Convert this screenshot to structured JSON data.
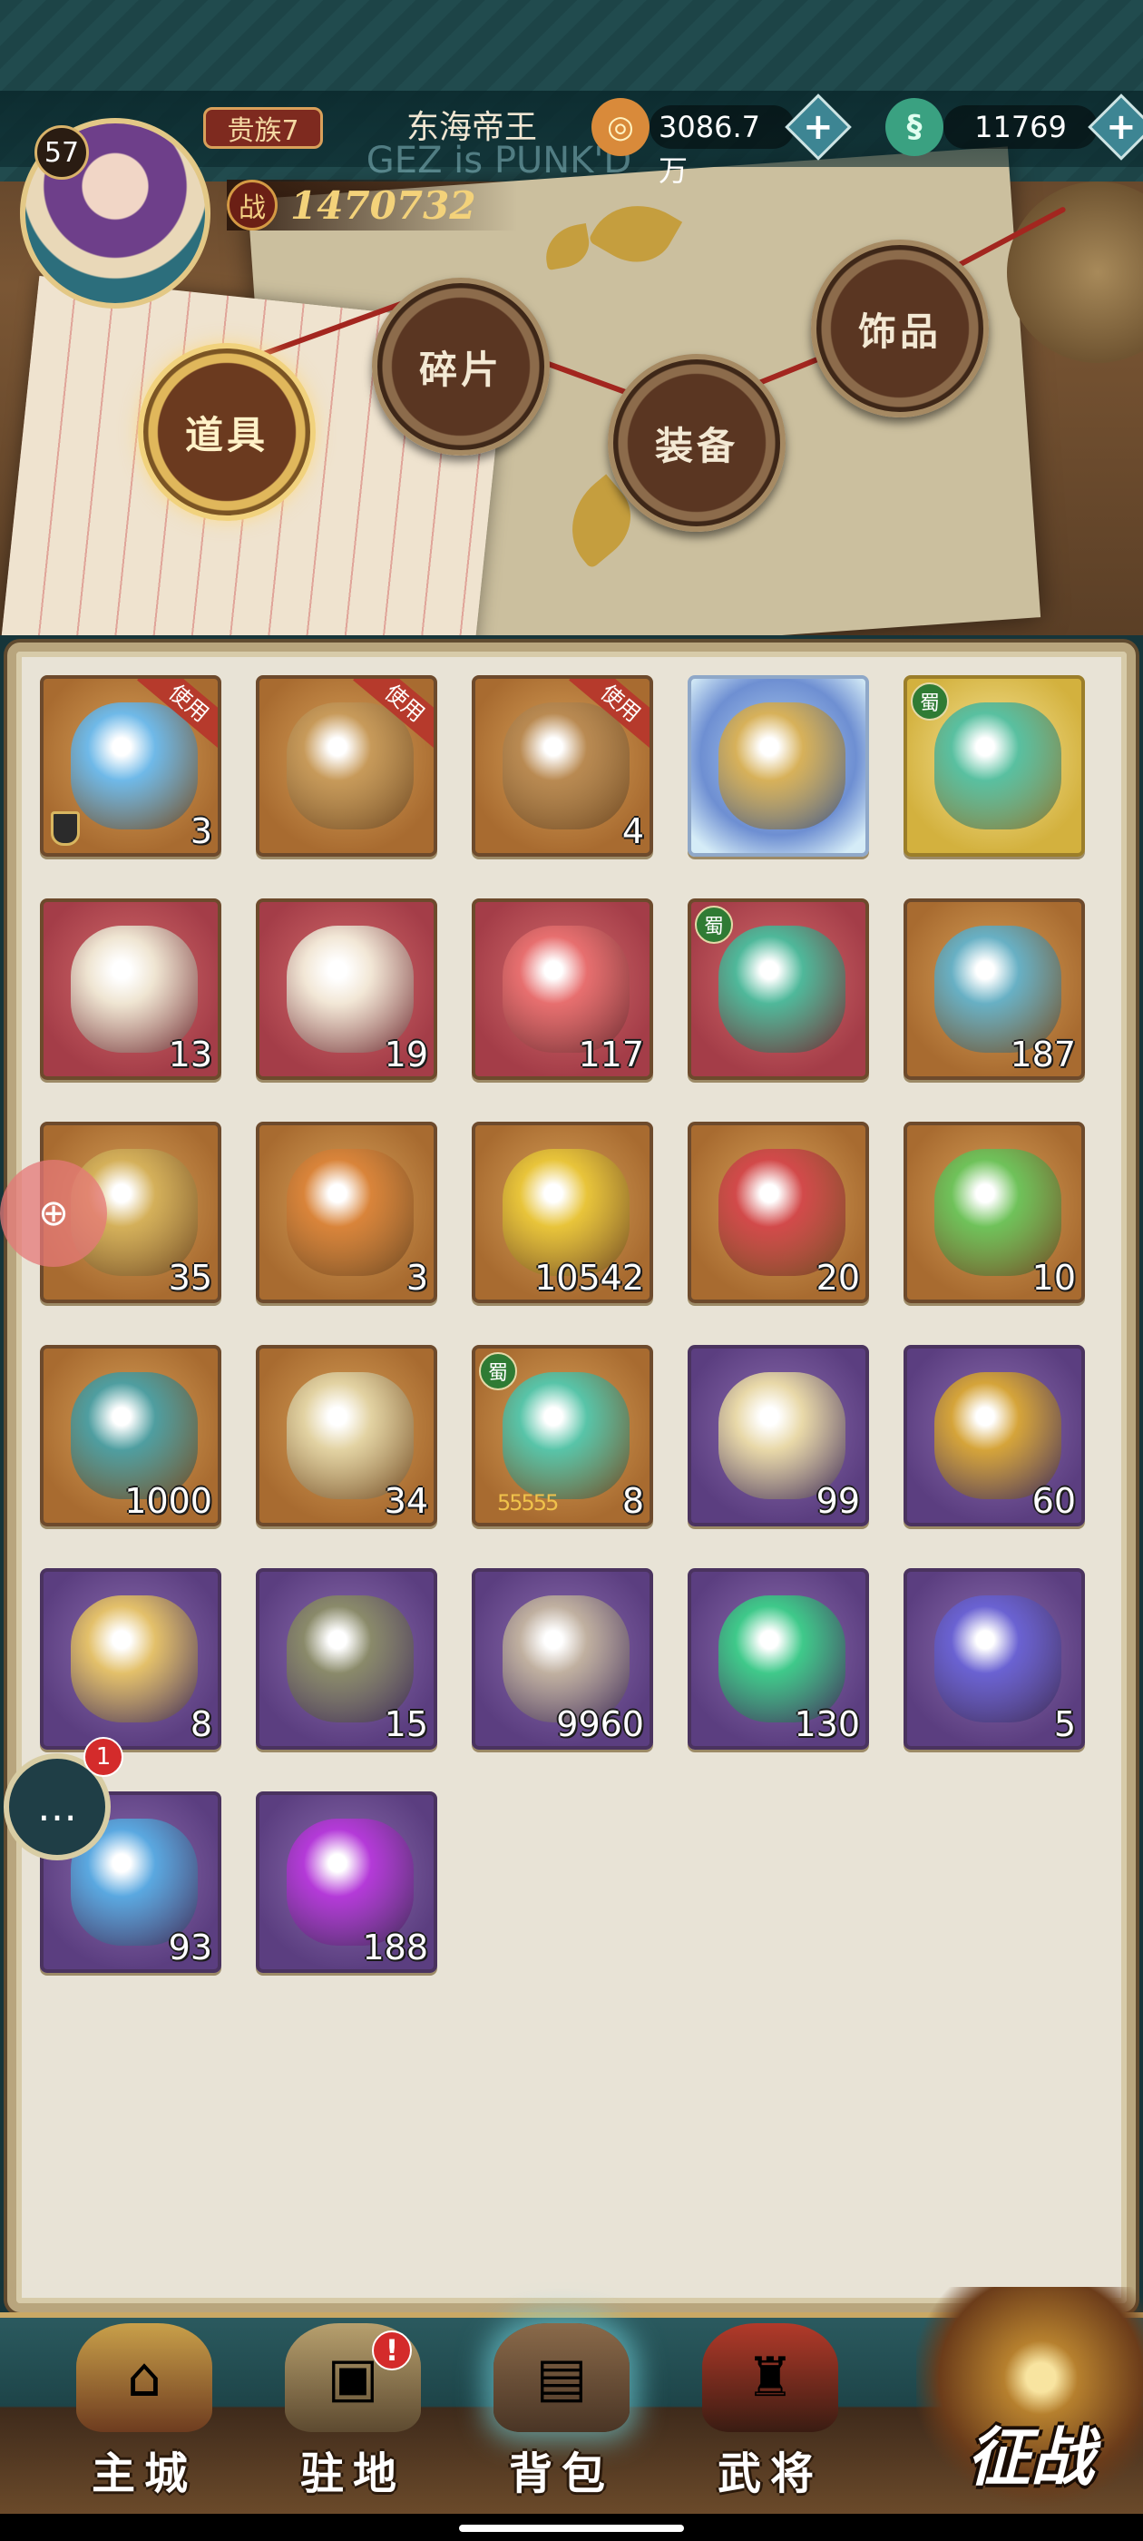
{
  "header": {
    "level": "57",
    "rank": "贵族7",
    "player_name": "东海帝王",
    "watermark": "GEZ is PUNK'D",
    "power_icon_label": "战",
    "power": "1470732",
    "currencies": [
      {
        "icon": "copper-coin-icon",
        "value": "3086.7万",
        "color": "#d98a3a"
      },
      {
        "icon": "jade-dragon-icon",
        "value": "11769",
        "color": "#3aa181"
      }
    ]
  },
  "category_tabs": [
    {
      "label": "道具",
      "active": true
    },
    {
      "label": "碎片",
      "active": false
    },
    {
      "label": "装备",
      "active": false
    },
    {
      "label": "饰品",
      "active": false
    }
  ],
  "inventory": {
    "use_tag": "使用",
    "faction_tag": "蜀",
    "items": [
      {
        "icon": "mystery-stone-icon",
        "count": "3",
        "rarity": "orange",
        "use": true,
        "lock": true
      },
      {
        "icon": "treasure-chest-icon",
        "count": "",
        "rarity": "orange",
        "use": true
      },
      {
        "icon": "orb-crate-icon",
        "count": "4",
        "rarity": "orange",
        "use": true
      },
      {
        "icon": "golden-crown-emblem-icon",
        "count": "",
        "rarity": "blue"
      },
      {
        "icon": "faction-orb-pendant-icon",
        "count": "",
        "rarity": "gold",
        "faction": true
      },
      {
        "icon": "ivory-horn-icon",
        "count": "13",
        "rarity": "red"
      },
      {
        "icon": "seashell-icon",
        "count": "19",
        "rarity": "red"
      },
      {
        "icon": "red-jade-lion-icon",
        "count": "117",
        "rarity": "red"
      },
      {
        "icon": "faction-jade-orb-icon",
        "count": "",
        "rarity": "red",
        "faction": true
      },
      {
        "icon": "sword-emblem-icon",
        "count": "187",
        "rarity": "orange"
      },
      {
        "icon": "golden-helmet-badge-icon",
        "count": "35",
        "rarity": "orange"
      },
      {
        "icon": "talisman-card-icon",
        "count": "3",
        "rarity": "orange"
      },
      {
        "icon": "golden-pearl-box-icon",
        "count": "10542",
        "rarity": "orange"
      },
      {
        "icon": "red-crystal-icon",
        "count": "20",
        "rarity": "orange"
      },
      {
        "icon": "green-crystal-icon",
        "count": "10",
        "rarity": "orange"
      },
      {
        "icon": "bronze-bell-icon",
        "count": "1000",
        "rarity": "orange"
      },
      {
        "icon": "jade-coin-icon",
        "count": "34",
        "rarity": "orange"
      },
      {
        "icon": "starred-faction-orb-icon",
        "count": "8",
        "rarity": "orange",
        "faction": true,
        "stars": "55555"
      },
      {
        "icon": "scroll-cards-icon",
        "count": "99",
        "rarity": "purple"
      },
      {
        "icon": "armillary-sphere-icon",
        "count": "60",
        "rarity": "purple"
      },
      {
        "icon": "imperial-scroll-icon",
        "count": "8",
        "rarity": "purple"
      },
      {
        "icon": "bronze-key-icon",
        "count": "15",
        "rarity": "purple"
      },
      {
        "icon": "dragon-dagger-icon",
        "count": "9960",
        "rarity": "purple"
      },
      {
        "icon": "green-flame-icon",
        "count": "130",
        "rarity": "purple"
      },
      {
        "icon": "purple-orb-icon",
        "count": "5",
        "rarity": "purple"
      },
      {
        "icon": "blue-ribbon-charm-icon",
        "count": "93",
        "rarity": "purple"
      },
      {
        "icon": "purple-gem-icon",
        "count": "188",
        "rarity": "purple"
      }
    ]
  },
  "floating": {
    "game_icon": "gamepad-icon",
    "chat_icon": "chat-bubble-icon",
    "chat_badge": "1"
  },
  "bottom_nav": {
    "items": [
      {
        "label": "主城",
        "icon": "palace-icon"
      },
      {
        "label": "驻地",
        "icon": "stronghold-icon",
        "alert": "!"
      },
      {
        "label": "背包",
        "icon": "backpack-chest-icon",
        "active": true
      },
      {
        "label": "武将",
        "icon": "general-helmet-icon"
      }
    ],
    "campaign_label": "征战"
  }
}
